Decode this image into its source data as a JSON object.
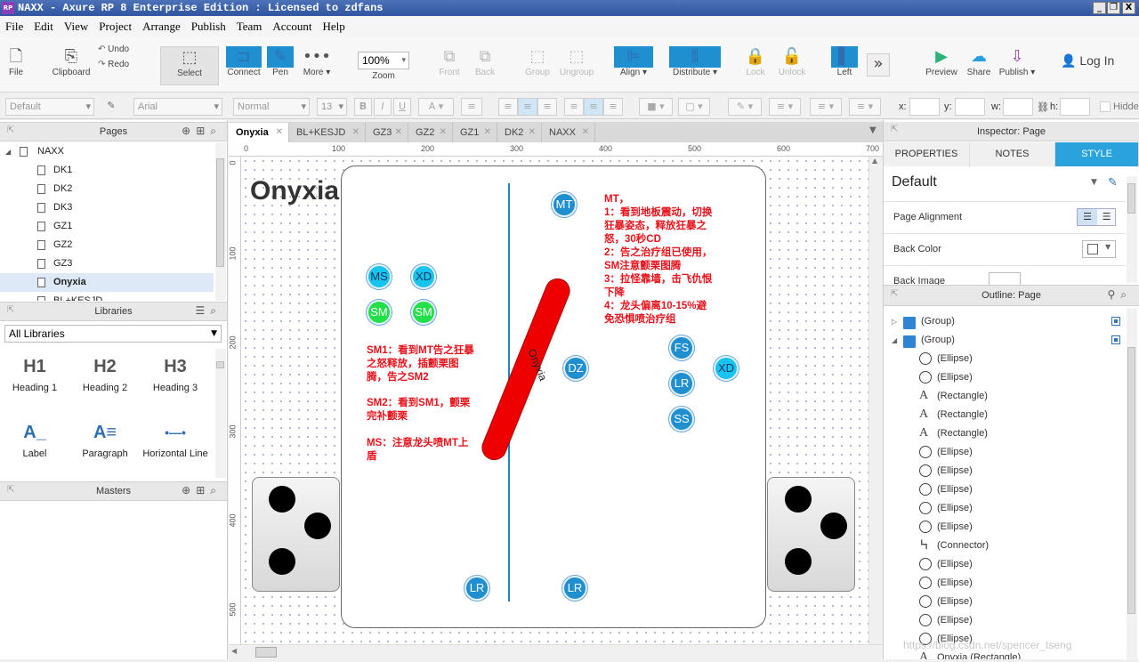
{
  "window": {
    "title": "NAXX - Axure RP 8 Enterprise Edition : Licensed to zdfans",
    "app_icon": "RP",
    "min_btn": "_",
    "max_btn": "❐",
    "close_btn": "X"
  },
  "menu": [
    "File",
    "Edit",
    "View",
    "Project",
    "Arrange",
    "Publish",
    "Team",
    "Account",
    "Help"
  ],
  "toolbar": {
    "file": "File",
    "clipboard": "Clipboard",
    "undo": "Undo",
    "redo": "Redo",
    "select": "Select",
    "connect": "Connect",
    "pen": "Pen",
    "more": "More ▾",
    "zoom_value": "100%",
    "zoom": "Zoom",
    "front": "Front",
    "back": "Back",
    "group": "Group",
    "ungroup": "Ungroup",
    "align": "Align ▾",
    "distribute": "Distribute ▾",
    "lock": "Lock",
    "unlock": "Unlock",
    "left": "Left",
    "overflow": "»",
    "preview": "Preview",
    "share": "Share",
    "publish": "Publish ▾",
    "login": "Log In"
  },
  "format": {
    "style": "Default",
    "font": "Arial",
    "weight": "Normal",
    "size": "13",
    "bold": "B",
    "italic": "I",
    "underline": "U",
    "x_label": "x:",
    "y_label": "y:",
    "w_label": "w:",
    "h_label": "h:",
    "hidden": "Hidden"
  },
  "pages": {
    "header": "Pages",
    "root": "NAXX",
    "items": [
      "DK1",
      "DK2",
      "DK3",
      "GZ1",
      "GZ2",
      "GZ3",
      "Onyxia",
      "BL+KESJD"
    ],
    "selected": "Onyxia"
  },
  "libraries": {
    "header": "Libraries",
    "dropdown": "All Libraries",
    "items": [
      {
        "glyph": "H1",
        "label": "Heading 1"
      },
      {
        "glyph": "H2",
        "label": "Heading 2"
      },
      {
        "glyph": "H3",
        "label": "Heading 3"
      },
      {
        "glyph": "A_",
        "label": "Label"
      },
      {
        "glyph": "A≡",
        "label": "Paragraph"
      },
      {
        "glyph": "•—•",
        "label": "Horizontal Line"
      }
    ]
  },
  "masters": {
    "header": "Masters"
  },
  "tabs": [
    "Onyxia",
    "BL+KESJD",
    "GZ3",
    "GZ2",
    "GZ1",
    "DK2",
    "NAXX"
  ],
  "ruler": {
    "h": [
      "0",
      "100",
      "200",
      "300",
      "400",
      "500",
      "600",
      "700"
    ],
    "v": [
      "0",
      "100",
      "200",
      "300",
      "400",
      "500"
    ]
  },
  "canvas": {
    "page_title": "Onyxia",
    "boss_label": "Onyxia",
    "circles": {
      "mt": "MT",
      "ms": "MS",
      "xd1": "XD",
      "sm1": "SM",
      "sm2": "SM",
      "dz": "DZ",
      "fs": "FS",
      "lr1": "LR",
      "xd2": "XD",
      "ss": "SS",
      "lr2": "LR",
      "lr3": "LR"
    },
    "note_mt": "MT，\n1：看到地板震动，切换狂暴姿态，释放狂暴之怒，30秒CD\n2：告之治疗组已使用，SM注意颤栗图腾\n3：拉怪靠墙，击飞仇恨下降\n4：龙头偏离10-15%避免恐惧喷治疗组",
    "note_sm1": "SM1：看到MT告之狂暴之怒释放，插颤栗图腾，告之SM2",
    "note_sm2": "SM2：看到SM1，颤栗完补颤栗",
    "note_ms": "MS：注意龙头喷MT上盾"
  },
  "inspector": {
    "title": "Inspector: Page",
    "tabs": [
      "PROPERTIES",
      "NOTES",
      "STYLE"
    ],
    "active_tab": "STYLE",
    "style_name": "Default",
    "page_alignment": "Page Alignment",
    "back_color": "Back Color",
    "back_image": "Back Image"
  },
  "outline": {
    "title": "Outline: Page",
    "rows": [
      {
        "type": "group",
        "label": "(Group)"
      },
      {
        "type": "group",
        "label": "(Group)"
      },
      {
        "type": "ellipse",
        "label": "(Ellipse)"
      },
      {
        "type": "ellipse",
        "label": "(Ellipse)"
      },
      {
        "type": "rect",
        "label": "(Rectangle)"
      },
      {
        "type": "rect",
        "label": "(Rectangle)"
      },
      {
        "type": "rect",
        "label": "(Rectangle)"
      },
      {
        "type": "ellipse",
        "label": "(Ellipse)"
      },
      {
        "type": "ellipse",
        "label": "(Ellipse)"
      },
      {
        "type": "ellipse",
        "label": "(Ellipse)"
      },
      {
        "type": "ellipse",
        "label": "(Ellipse)"
      },
      {
        "type": "ellipse",
        "label": "(Ellipse)"
      },
      {
        "type": "connector",
        "label": "(Connector)"
      },
      {
        "type": "ellipse",
        "label": "(Ellipse)"
      },
      {
        "type": "ellipse",
        "label": "(Ellipse)"
      },
      {
        "type": "ellipse",
        "label": "(Ellipse)"
      },
      {
        "type": "ellipse",
        "label": "(Ellipse)"
      },
      {
        "type": "ellipse",
        "label": "(Ellipse)"
      },
      {
        "type": "text",
        "label": "Onyxia (Rectangle)"
      }
    ]
  },
  "watermark": "https://blog.csdn.net/spencer_tseng"
}
